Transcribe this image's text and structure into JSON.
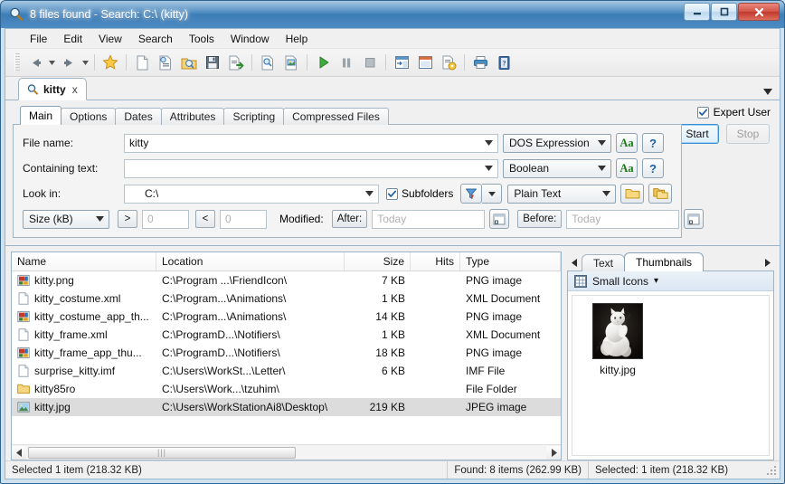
{
  "window": {
    "title": "8 files found - Search: C:\\ (kitty)",
    "icon": "magnifier-icon",
    "minimize_label": "Minimize",
    "maximize_label": "Maximize",
    "close_label": "Close"
  },
  "menubar": {
    "items": [
      "File",
      "Edit",
      "View",
      "Search",
      "Tools",
      "Window",
      "Help"
    ]
  },
  "toolbar": {
    "buttons": [
      {
        "name": "back-icon",
        "label": "Back"
      },
      {
        "name": "forward-icon",
        "label": "Forward"
      },
      {
        "name": "favorites-star-icon",
        "label": "Favorites"
      },
      {
        "name": "new-document-icon",
        "label": "New"
      },
      {
        "name": "open-document-icon",
        "label": "Open"
      },
      {
        "name": "open-folder-icon",
        "label": "Open Search"
      },
      {
        "name": "save-icon",
        "label": "Save"
      },
      {
        "name": "export-icon",
        "label": "Export"
      },
      {
        "name": "preview-document-icon",
        "label": "Preview"
      },
      {
        "name": "view-document-icon",
        "label": "View"
      },
      {
        "name": "start-play-icon",
        "label": "Start"
      },
      {
        "name": "pause-icon",
        "label": "Pause"
      },
      {
        "name": "stop-icon",
        "label": "Stop"
      },
      {
        "name": "panel-layout-icon",
        "label": "Layout"
      },
      {
        "name": "window-split-icon",
        "label": "Split"
      },
      {
        "name": "document-settings-icon",
        "label": "Settings"
      },
      {
        "name": "print-icon",
        "label": "Print"
      },
      {
        "name": "help-book-icon",
        "label": "Help"
      }
    ]
  },
  "doc_tab": {
    "label": "kitty",
    "close_label": "x",
    "icon": "magnifier-icon",
    "overflow_label": "▼"
  },
  "criteria": {
    "expert_user_label": "Expert User",
    "expert_user_checked": true,
    "tabs": [
      {
        "label": "Main",
        "active": true
      },
      {
        "label": "Options",
        "active": false
      },
      {
        "label": "Dates",
        "active": false
      },
      {
        "label": "Attributes",
        "active": false
      },
      {
        "label": "Scripting",
        "active": false
      },
      {
        "label": "Compressed Files",
        "active": false
      }
    ],
    "file_name": {
      "label": "File name:",
      "value": "kitty",
      "mode": "DOS Expression",
      "case_button": "Aa",
      "help_button": "?"
    },
    "containing_text": {
      "label": "Containing text:",
      "value": "",
      "placeholder": "",
      "mode": "Boolean",
      "case_button": "Aa",
      "help_button": "?"
    },
    "look_in": {
      "label": "Look in:",
      "value": "C:\\",
      "subfolders_label": "Subfolders",
      "subfolders_checked": true,
      "filter_icon": "funnel-filter-icon",
      "text_mode": "Plain Text",
      "browse_folder_icon": "folder-icon",
      "browse_folders_icon": "multi-folder-icon"
    },
    "size_row": {
      "unit": "Size (kB)",
      "greater_op": ">",
      "greater_value": "0",
      "less_op": "<",
      "less_value": "0",
      "modified_label": "Modified:",
      "after_label": "After:",
      "after_value": "Today",
      "before_label": "Before:",
      "before_value": "Today",
      "calendar_icon": "calendar-icon"
    },
    "start_button": "Start",
    "stop_button": "Stop"
  },
  "results": {
    "columns": [
      "Name",
      "Location",
      "Size",
      "Hits",
      "Type"
    ],
    "rows": [
      {
        "icon": "png-image-icon",
        "name": "kitty.png",
        "location": "C:\\Program ...\\FriendIcon\\",
        "size": "7 KB",
        "hits": "",
        "type": "PNG image",
        "selected": false
      },
      {
        "icon": "blank-document-icon",
        "name": "kitty_costume.xml",
        "location": "C:\\Program...\\Animations\\",
        "size": "1 KB",
        "hits": "",
        "type": "XML Document",
        "selected": false
      },
      {
        "icon": "png-image-icon",
        "name": "kitty_costume_app_th...",
        "location": "C:\\Program...\\Animations\\",
        "size": "14 KB",
        "hits": "",
        "type": "PNG image",
        "selected": false
      },
      {
        "icon": "blank-document-icon",
        "name": "kitty_frame.xml",
        "location": "C:\\ProgramD...\\Notifiers\\",
        "size": "1 KB",
        "hits": "",
        "type": "XML Document",
        "selected": false
      },
      {
        "icon": "png-image-icon",
        "name": "kitty_frame_app_thu...",
        "location": "C:\\ProgramD...\\Notifiers\\",
        "size": "18 KB",
        "hits": "",
        "type": "PNG image",
        "selected": false
      },
      {
        "icon": "blank-document-icon",
        "name": "surprise_kitty.imf",
        "location": "C:\\Users\\WorkSt...\\Letter\\",
        "size": "6 KB",
        "hits": "",
        "type": "IMF File",
        "selected": false
      },
      {
        "icon": "folder-icon",
        "name": "kitty85ro",
        "location": "C:\\Users\\Work...\\tzuhim\\",
        "size": "",
        "hits": "",
        "type": "File Folder",
        "selected": false
      },
      {
        "icon": "jpeg-image-icon",
        "name": "kitty.jpg",
        "location": "C:\\Users\\WorkStationAi8\\Desktop\\",
        "size": "219 KB",
        "hits": "",
        "type": "JPEG image",
        "selected": true
      }
    ]
  },
  "preview": {
    "scroll_left_icon": "chevron-left-icon",
    "scroll_right_icon": "chevron-right-icon",
    "tabs": [
      {
        "label": "Text",
        "active": false
      },
      {
        "label": "Thumbnails",
        "active": true
      }
    ],
    "view_mode": "Small Icons",
    "view_mode_icon": "grid-icon",
    "view_mode_caret": "▾",
    "thumbnail": {
      "caption": "kitty.jpg",
      "alt": "white-cat-photo"
    }
  },
  "hscroll": {
    "left_arrow": "◀",
    "right_arrow": "▶",
    "grip": "|||"
  },
  "statusbar": {
    "left": "Selected 1 item (218.32 KB)",
    "middle": "Found: 8 items (262.99 KB)",
    "right": "Selected: 1 item (218.32 KB)"
  },
  "colors": {
    "titlebar_blue": "#3c7cb4",
    "close_red": "#c03a2d",
    "selection_gray": "#dcdcdc",
    "accent_green": "#1a7a1a",
    "accent_blue": "#1c5fa8"
  }
}
